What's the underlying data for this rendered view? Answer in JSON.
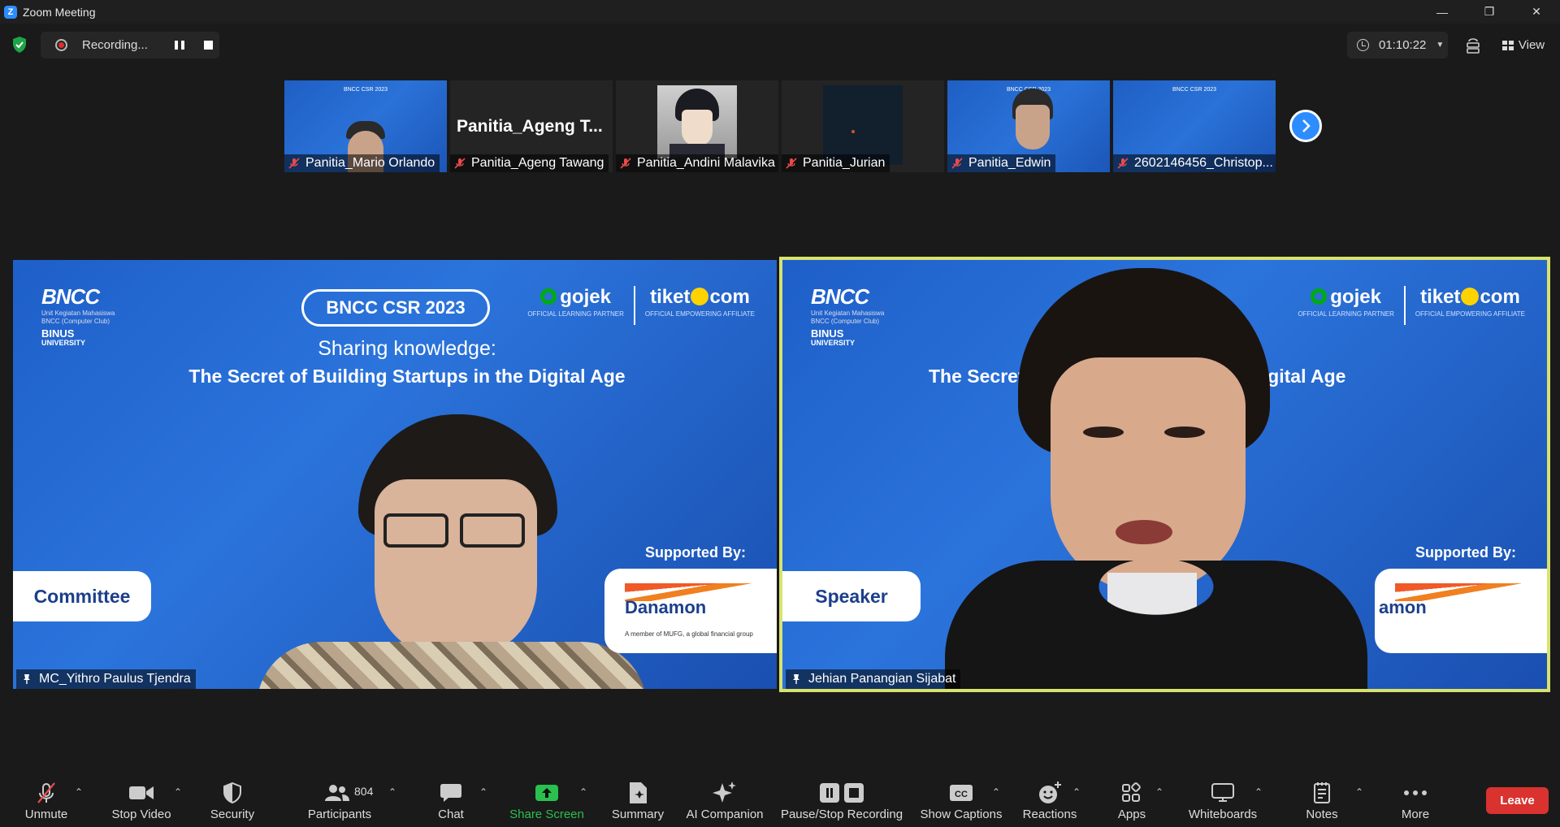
{
  "window": {
    "title": "Zoom Meeting",
    "minimize": "—",
    "restore": "❐",
    "close": "✕"
  },
  "topbar": {
    "recording_label": "Recording...",
    "timer": "01:10:22",
    "view_label": "View"
  },
  "filmstrip": [
    {
      "name": "Panitia_Mario Orlando",
      "type": "video"
    },
    {
      "name": "Panitia_Ageng Tawang",
      "display_title": "Panitia_Ageng T...",
      "type": "name"
    },
    {
      "name": "Panitia_Andini Malavika",
      "type": "avatar"
    },
    {
      "name": "Panitia_Jurian",
      "type": "avatar-dark"
    },
    {
      "name": "Panitia_Edwin",
      "type": "video"
    },
    {
      "name": "2602146456_Christop...",
      "type": "video"
    }
  ],
  "slide": {
    "org": "BNCC",
    "org_sub": "Unit Kegiatan Mahasiswa\nBNCC (Computer Club)",
    "univ1": "BINUS",
    "univ2": "UNIVERSITY",
    "badge": "BNCC CSR 2023",
    "sharing": "Sharing knowledge:",
    "headline": "The Secret of Building Startups in the Digital Age",
    "partner1": "gojek",
    "partner1_sub": "OFFICIAL LEARNING PARTNER",
    "partner2_a": "tiket",
    "partner2_b": "com",
    "partner2_sub": "OFFICIAL EMPOWERING AFFILIATE",
    "supported_by": "Supported By:",
    "sponsor": "Danamon",
    "sponsor_sub": "A member of MUFG, a global financial group"
  },
  "main_videos": [
    {
      "name": "MC_Yithro Paulus Tjendra",
      "role": "Committee",
      "headline": "The Secret of Building Startups in the Digital Age"
    },
    {
      "name": "Jehian Panangian Sijabat",
      "role": "Speaker",
      "headline_left": "The Secret",
      "headline_right": "e Digital Age",
      "sponsor": "amon"
    }
  ],
  "toolbar": {
    "unmute": "Unmute",
    "stop_video": "Stop Video",
    "security": "Security",
    "participants": "Participants",
    "participants_count": "804",
    "chat": "Chat",
    "share_screen": "Share Screen",
    "summary": "Summary",
    "ai_companion": "AI Companion",
    "pause_stop_recording": "Pause/Stop Recording",
    "show_captions": "Show Captions",
    "reactions": "Reactions",
    "apps": "Apps",
    "whiteboards": "Whiteboards",
    "notes": "Notes",
    "more": "More",
    "leave": "Leave"
  },
  "colors": {
    "accent": "#2d8cff",
    "leave": "#d9322f",
    "share": "#29c04e",
    "active_speaker": "#d8e26e",
    "slide_blue": "#2a6fd6"
  }
}
